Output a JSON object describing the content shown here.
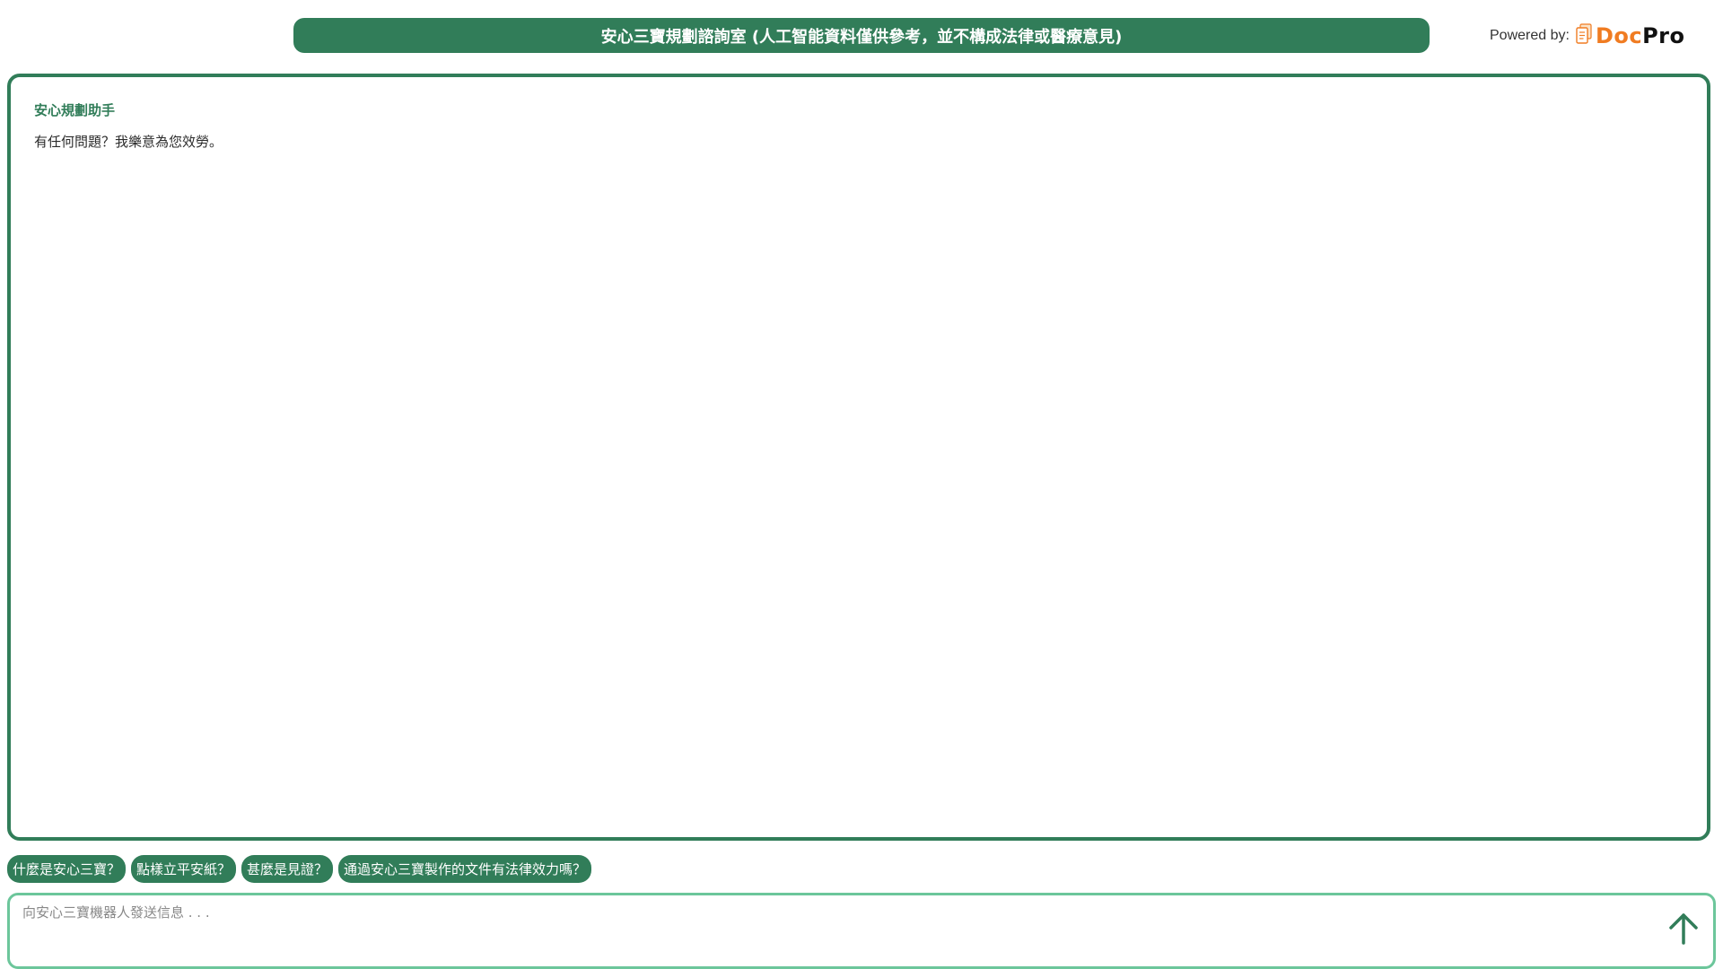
{
  "header": {
    "title": "安心三寶規劃諮詢室 (人工智能資料僅供參考，並不構成法律或醫療意見)",
    "powered_label": "Powered by:",
    "logo_icon": "document-stack-icon",
    "logo_doc": "Doc",
    "logo_pro": "Pro"
  },
  "chat": {
    "messages": [
      {
        "sender": "安心規劃助手",
        "text": "有任何問題？我樂意為您效勞。"
      }
    ]
  },
  "suggestions": [
    "什麼是安心三寶？",
    "點樣立平安紙？",
    "甚麼是見證？",
    "通過安心三寶製作的文件有法律效力嗎？"
  ],
  "input": {
    "placeholder": "向安心三寶機器人發送信息 . . .",
    "value": "",
    "send_icon": "arrow-up-icon"
  },
  "colors": {
    "primary": "#317d59",
    "input_border": "#6cc69b",
    "logo_orange": "#f07c22",
    "logo_dark": "#111111"
  }
}
